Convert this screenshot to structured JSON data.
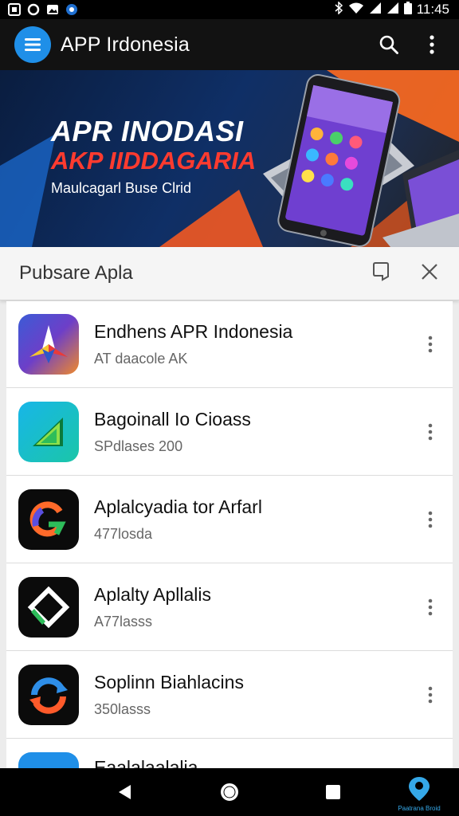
{
  "status_bar": {
    "time": "11:45",
    "left_icons": [
      "app-notification-icon",
      "circle-notification-icon",
      "image-notification-icon",
      "browser-notification-icon"
    ],
    "right_icons": [
      "bluetooth-icon",
      "wifi-icon",
      "signal-icon",
      "signal-icon",
      "battery-icon"
    ]
  },
  "toolbar": {
    "title": "APP Irdonesia",
    "accent": "#1f8fe8",
    "icons": [
      "menu-icon",
      "search-icon",
      "more-vert-icon"
    ]
  },
  "banner": {
    "headline": "APR INODASI",
    "headline2": "AKP IIDDAGARIA",
    "subtitle": "Maulcagarl Buse Clrid",
    "headline2_color": "#ff3b2f"
  },
  "panel": {
    "title": "Pubsare Apla",
    "icons": [
      "bookmark-icon",
      "close-icon"
    ]
  },
  "apps": [
    {
      "name": "Endhens APR Indonesia",
      "subtitle": "AT daacole AK",
      "icon": "compass-star-icon"
    },
    {
      "name": "Bagoinall Io Cioass",
      "subtitle": "SPdlases 200",
      "icon": "green-triangle-icon"
    },
    {
      "name": "Aplalcyadia tor Arfarl",
      "subtitle": "477losda",
      "icon": "colorful-g-icon"
    },
    {
      "name": "Aplalty Apllalis",
      "subtitle": "A77lasss",
      "icon": "green-diamond-icon"
    },
    {
      "name": "Soplinn Biahlacins",
      "subtitle": "350lasss",
      "icon": "refresh-arrows-icon"
    },
    {
      "name": "Eaalalaalalia",
      "subtitle": "",
      "icon": "blue-circle-icon"
    }
  ],
  "nav_bar": {
    "icons": [
      "back-icon",
      "home-icon",
      "recents-icon",
      "location-pin-icon"
    ],
    "badge_label": "Paatrana Broid"
  }
}
